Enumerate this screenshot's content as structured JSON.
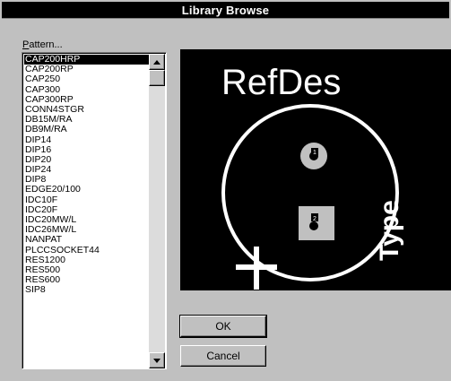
{
  "window": {
    "title": "Library Browse"
  },
  "pattern": {
    "label_accel": "P",
    "label_rest": "attern..."
  },
  "list": {
    "selected_index": 0,
    "items": [
      "CAP200HRP",
      "CAP200RP",
      "CAP250",
      "CAP300",
      "CAP300RP",
      "CONN4STGR",
      "DB15M/RA",
      "DB9M/RA",
      "DIP14",
      "DIP16",
      "DIP20",
      "DIP24",
      "DIP8",
      "EDGE20/100",
      "IDC10F",
      "IDC20F",
      "IDC20MW/L",
      "IDC26MW/L",
      "NANPAT",
      "PLCCSOCKET44",
      "RES1200",
      "RES500",
      "RES600",
      "SIP8"
    ]
  },
  "preview": {
    "refdes_label": "RefDes",
    "type_label": "Type",
    "pin1_label": "1",
    "pin2_label": "2",
    "pad_color": "#c0c0c0",
    "silk_color": "#ffffff",
    "background": "#000000"
  },
  "buttons": {
    "ok": "OK",
    "cancel": "Cancel"
  }
}
